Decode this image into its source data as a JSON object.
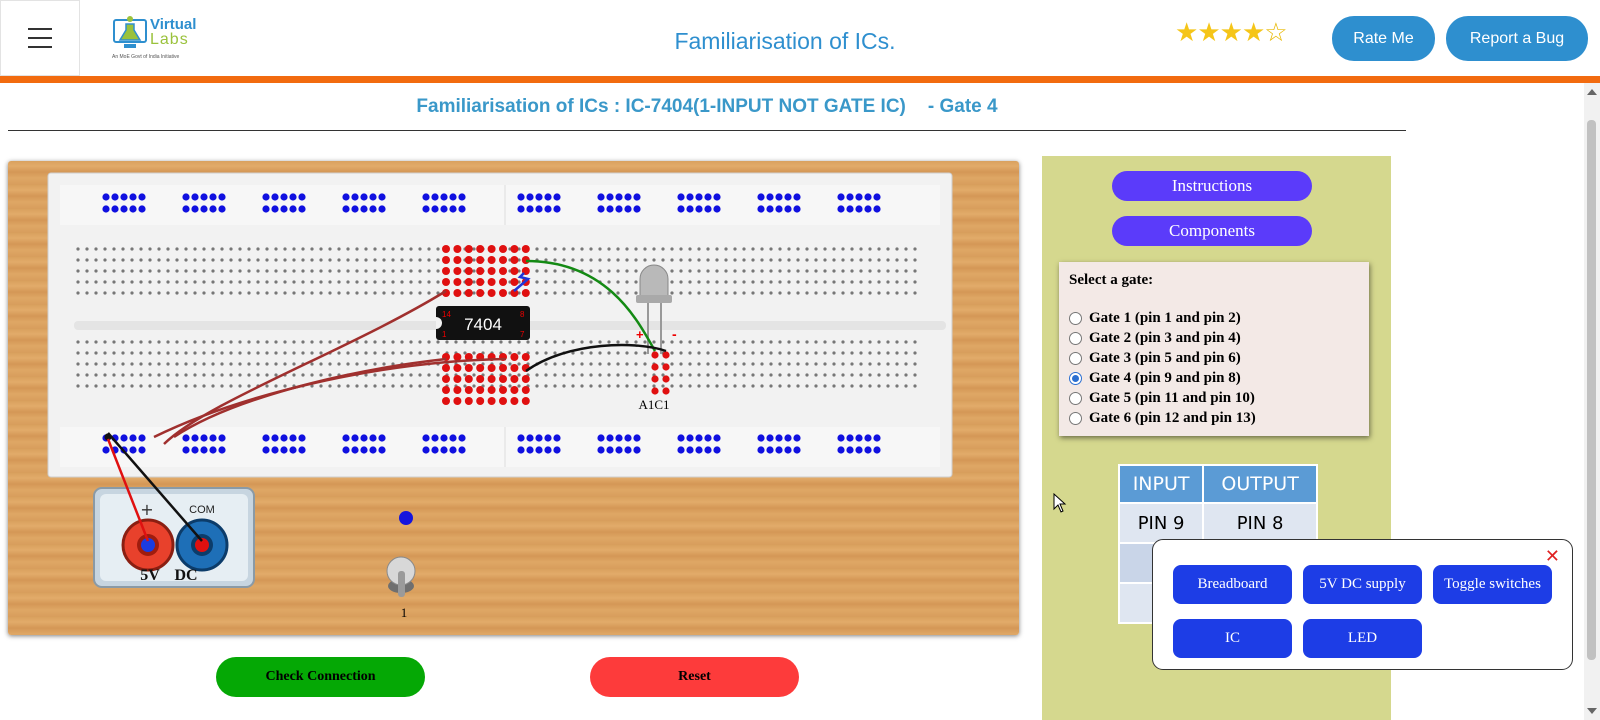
{
  "header": {
    "menu_icon": "hamburger-icon",
    "logo": {
      "line1": "Virtual",
      "line2": "Labs",
      "tagline": "An MoE Govt of India Initiative"
    },
    "title": "Familiarisation of ICs.",
    "rating": {
      "value": 4,
      "max": 5
    },
    "rate_label": "Rate Me",
    "bug_label": "Report a Bug",
    "accent_color": "#f26b0f",
    "brand_color": "#2e8fcf"
  },
  "page": {
    "heading": "Familiarisation of ICs : IC-7404(1-INPUT NOT GATE IC)",
    "gate_label": "- Gate 4"
  },
  "board": {
    "ic_label": "7404",
    "ic_pin_left_top": "14",
    "ic_pin_left_bottom": "1",
    "ic_pin_right_top": "8",
    "ic_pin_right_bottom": "7",
    "led_plus": "+",
    "led_minus": "-",
    "led_label": "A1C1",
    "supply_plus": "+",
    "supply_com": "COM",
    "supply_label_v": "5V",
    "supply_label_dc": "DC",
    "switch_label": "1"
  },
  "actions": {
    "check_label": "Check Connection",
    "reset_label": "Reset"
  },
  "panel": {
    "instructions_label": "Instructions",
    "components_label": "Components",
    "select_title": "Select a gate:",
    "gates": [
      {
        "label": "Gate 1 (pin 1 and pin 2)",
        "checked": false
      },
      {
        "label": "Gate 2 (pin 3 and pin 4)",
        "checked": false
      },
      {
        "label": "Gate 3 (pin 5 and pin 6)",
        "checked": false
      },
      {
        "label": "Gate 4 (pin 9 and pin 8)",
        "checked": true
      },
      {
        "label": "Gate 5 (pin 11 and pin 10)",
        "checked": false
      },
      {
        "label": "Gate 6 (pin 12 and pin 13)",
        "checked": false
      }
    ],
    "table": {
      "headers": [
        "INPUT",
        "OUTPUT"
      ],
      "rows": [
        [
          "PIN 9",
          "PIN 8"
        ]
      ]
    }
  },
  "popup": {
    "close_icon": "close-icon",
    "buttons": [
      "Breadboard",
      "5V DC supply",
      "Toggle switches",
      "IC",
      "LED"
    ]
  }
}
